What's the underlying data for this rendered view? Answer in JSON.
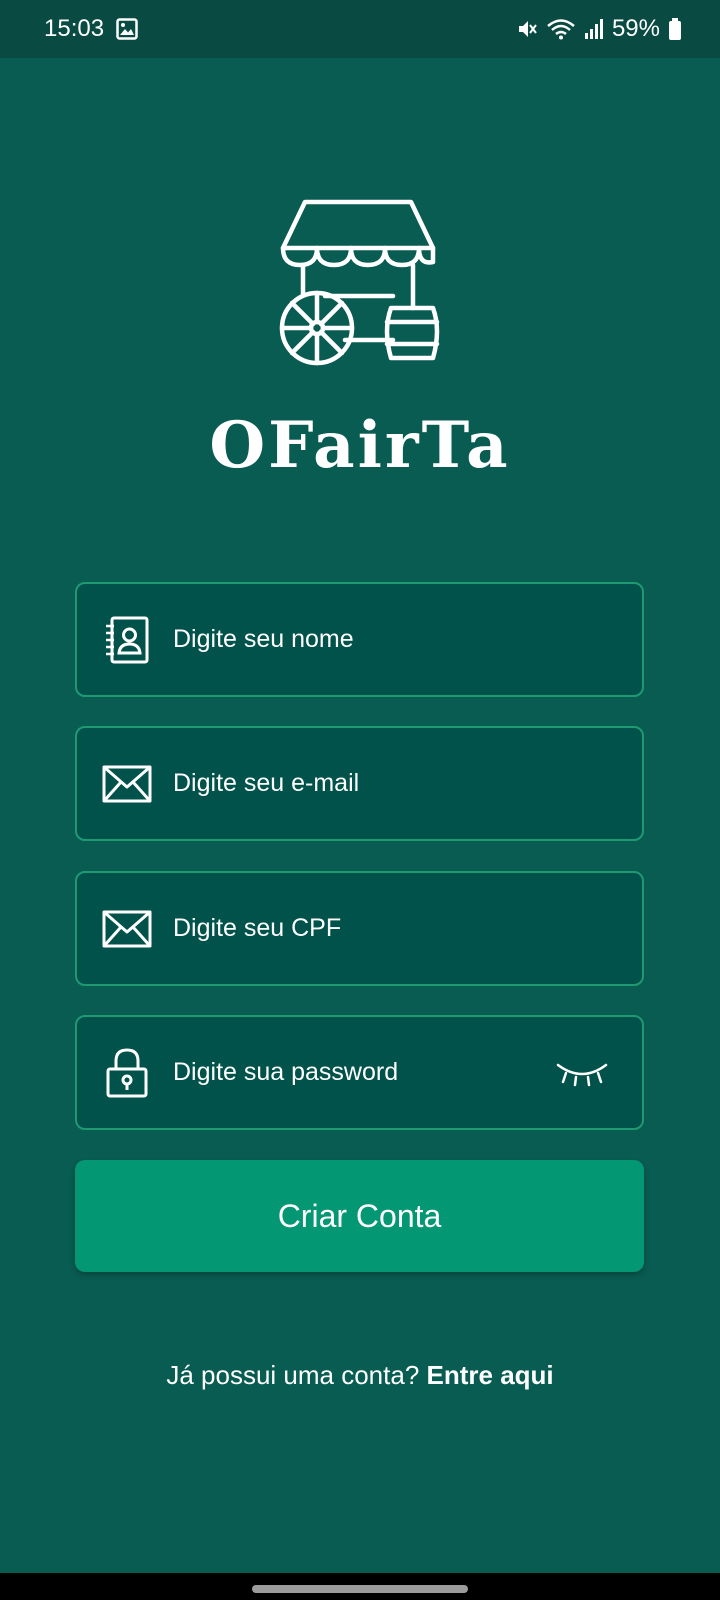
{
  "status_bar": {
    "time": "15:03",
    "battery": "59%",
    "icons": [
      "gallery-icon",
      "mute-icon",
      "wifi-icon",
      "signal-icon",
      "battery-icon"
    ]
  },
  "brand": {
    "name": "OFairTa",
    "logo_icon": "market-stall-cart-icon"
  },
  "form": {
    "name_placeholder": "Digite seu nome",
    "email_placeholder": "Digite seu e-mail",
    "cpf_placeholder": "Digite seu CPF",
    "password_placeholder": "Digite sua password"
  },
  "buttons": {
    "create_account": "Criar Conta"
  },
  "footer": {
    "prompt": "Já possui uma conta?",
    "link": "Entre aqui"
  },
  "colors": {
    "background": "#095c52",
    "status_bar": "#094b42",
    "field_bg": "#00524a",
    "field_border": "#1e9a73",
    "button": "#039773"
  }
}
